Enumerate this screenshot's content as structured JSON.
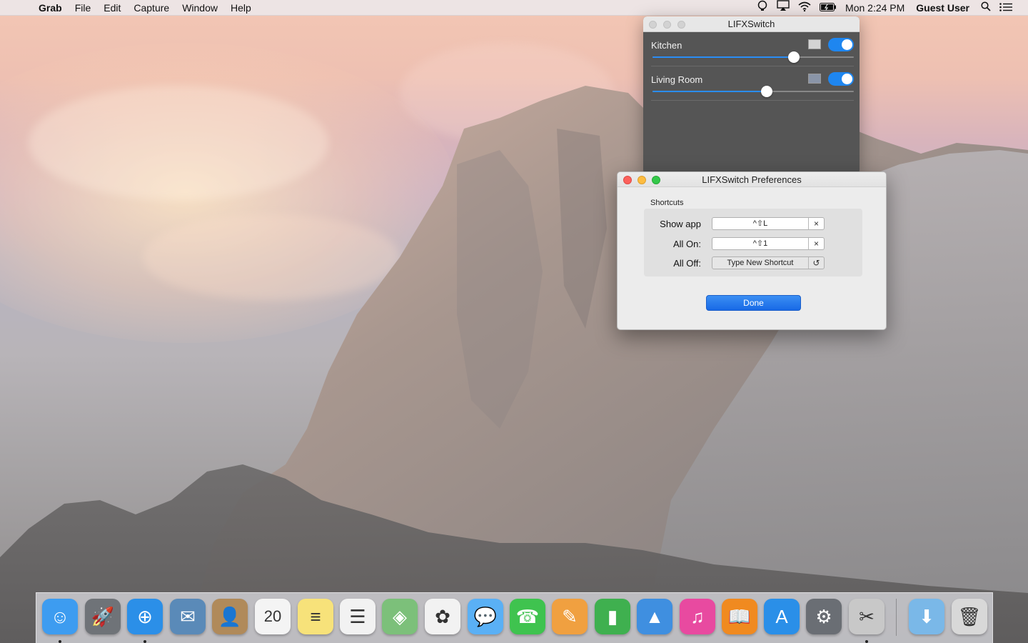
{
  "menubar": {
    "app_name": "Grab",
    "menus": [
      "File",
      "Edit",
      "Capture",
      "Window",
      "Help"
    ],
    "clock": "Mon 2:24 PM",
    "user": "Guest User",
    "status_icons": [
      "lifx-status-icon",
      "airplay-icon",
      "wifi-icon",
      "battery-icon"
    ]
  },
  "lifx_window": {
    "title": "LIFXSwitch",
    "lights": [
      {
        "name": "Kitchen",
        "on": true,
        "brightness": 0.84,
        "swatch_color": "#d4d4d4"
      },
      {
        "name": "Living Room",
        "on": true,
        "brightness": 0.68,
        "swatch_color": "#8a95a8"
      }
    ]
  },
  "prefs_window": {
    "title": "LIFXSwitch Preferences",
    "group_title": "Shortcuts",
    "shortcuts": [
      {
        "label": "Show app",
        "value": "^⇧L",
        "action": "×"
      },
      {
        "label": "All On:",
        "value": "^⇧1",
        "action": "×"
      },
      {
        "label": "All Off:",
        "value": "Type New Shortcut",
        "action": "↺"
      }
    ],
    "done_label": "Done"
  },
  "dock": {
    "items": [
      {
        "name": "finder",
        "glyph": "☺",
        "color": "#3d9cf0",
        "running": true
      },
      {
        "name": "launchpad",
        "glyph": "🚀",
        "color": "#6f7378",
        "running": false
      },
      {
        "name": "safari",
        "glyph": "⊕",
        "color": "#2b8fe8",
        "running": true
      },
      {
        "name": "mail",
        "glyph": "✉",
        "color": "#5a8ab8",
        "running": false
      },
      {
        "name": "contacts",
        "glyph": "👤",
        "color": "#b08a5a",
        "running": false
      },
      {
        "name": "calendar",
        "glyph": "20",
        "color": "#f4f4f4",
        "running": false
      },
      {
        "name": "notes",
        "glyph": "≡",
        "color": "#f7e27a",
        "running": false
      },
      {
        "name": "reminders",
        "glyph": "☰",
        "color": "#f2f2f2",
        "running": false
      },
      {
        "name": "maps",
        "glyph": "◈",
        "color": "#7cc07a",
        "running": false
      },
      {
        "name": "photos",
        "glyph": "✿",
        "color": "#f2f2f2",
        "running": false
      },
      {
        "name": "messages",
        "glyph": "💬",
        "color": "#5ab0f5",
        "running": false
      },
      {
        "name": "facetime",
        "glyph": "☎",
        "color": "#3fc34f",
        "running": false
      },
      {
        "name": "pages",
        "glyph": "✎",
        "color": "#f0a040",
        "running": false
      },
      {
        "name": "numbers",
        "glyph": "▮",
        "color": "#3fb04f",
        "running": false
      },
      {
        "name": "keynote",
        "glyph": "▲",
        "color": "#3f8fe0",
        "running": false
      },
      {
        "name": "itunes",
        "glyph": "♫",
        "color": "#e84aa0",
        "running": false
      },
      {
        "name": "ibooks",
        "glyph": "📖",
        "color": "#f08a20",
        "running": false
      },
      {
        "name": "app-store",
        "glyph": "A",
        "color": "#2a8fe8",
        "running": false
      },
      {
        "name": "system-preferences",
        "glyph": "⚙",
        "color": "#6a6e74",
        "running": false
      },
      {
        "name": "grab",
        "glyph": "✂",
        "color": "#c8c8c8",
        "running": true
      },
      {
        "name": "downloads-folder",
        "glyph": "⬇",
        "color": "#7ab8e8",
        "running": false
      },
      {
        "name": "trash",
        "glyph": "🗑",
        "color": "#d8d8d8",
        "running": false
      }
    ]
  }
}
